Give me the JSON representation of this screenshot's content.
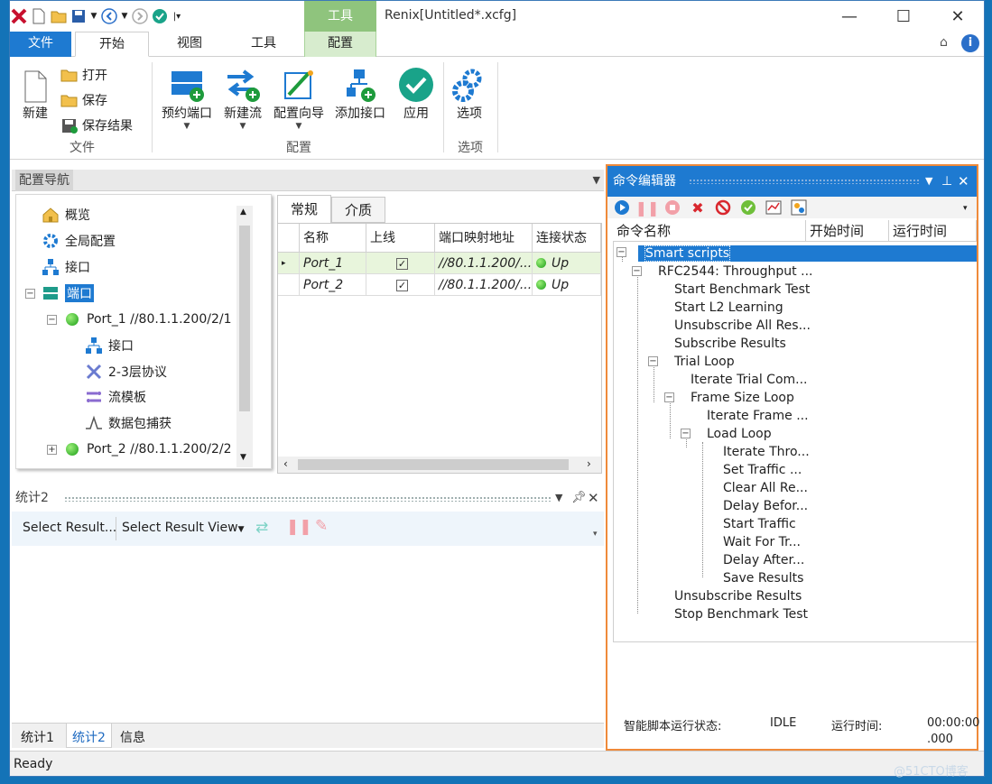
{
  "window": {
    "title": "Renix[Untitled*.xcfg]",
    "context_tab_group": "工具",
    "accent": "#1e7ad1",
    "context_color": "#8fc47d"
  },
  "tabs": [
    {
      "label": "文件",
      "active": false
    },
    {
      "label": "开始",
      "active": true
    },
    {
      "label": "视图",
      "active": false
    },
    {
      "label": "工具",
      "active": false
    },
    {
      "label": "配置",
      "active": false
    }
  ],
  "ribbon": {
    "file_group": {
      "label": "文件",
      "new": "新建",
      "open": "打开",
      "save": "保存",
      "save_result": "保存结果"
    },
    "config_group": {
      "label": "配置",
      "reserve_port": "预约端口",
      "new_stream": "新建流",
      "wizard": "配置向导",
      "add_interface": "添加接口",
      "apply": "应用"
    },
    "options_group": {
      "label": "选项",
      "options": "选项"
    }
  },
  "nav": {
    "title": "配置导航",
    "items": [
      {
        "label": "概览"
      },
      {
        "label": "全局配置"
      },
      {
        "label": "接口"
      },
      {
        "label": "端口"
      },
      {
        "label": "Port_1 //80.1.1.200/2/1"
      },
      {
        "label": "接口"
      },
      {
        "label": "2-3层协议"
      },
      {
        "label": "流模板"
      },
      {
        "label": "数据包捕获"
      },
      {
        "label": "Port_2 //80.1.1.200/2/2"
      }
    ]
  },
  "grid": {
    "tabs": [
      "常规",
      "介质"
    ],
    "columns": [
      "名称",
      "上线",
      "端口映射地址",
      "连接状态"
    ],
    "rows": [
      {
        "name": "Port_1",
        "online": "✓",
        "address": "//80.1.1.200/...",
        "status": "Up"
      },
      {
        "name": "Port_2",
        "online": "✓",
        "address": "//80.1.1.200/...",
        "status": "Up"
      }
    ]
  },
  "stats": {
    "title": "统计2",
    "select_result": "Select Result...",
    "select_view": "Select Result View",
    "bottom_tabs": [
      "统计1",
      "统计2",
      "信息"
    ]
  },
  "cmd": {
    "title": "命令编辑器",
    "columns": [
      "命令名称",
      "开始时间",
      "运行时间"
    ],
    "tree": [
      "Smart scripts",
      "RFC2544: Throughput ...",
      "Start Benchmark Test",
      "Start L2 Learning",
      "Unsubscribe All Res...",
      "Subscribe Results",
      "Trial Loop",
      "Iterate Trial Com...",
      "Frame Size Loop",
      "Iterate Frame ...",
      "Load Loop",
      "Iterate Thro...",
      "Set Traffic ...",
      "Clear All Re...",
      "Delay Befor...",
      "Start Traffic",
      "Wait For Tr...",
      "Delay After...",
      "Save Results",
      "Unsubscribe Results",
      "Stop Benchmark Test"
    ],
    "status_label": "智能脚本运行状态:",
    "status_value": "IDLE",
    "runtime_label": "运行时间:",
    "runtime_value": "00:00:00",
    "runtime_ms": ".000"
  },
  "statusbar": {
    "text": "Ready"
  },
  "watermark": "@51CTO博客"
}
